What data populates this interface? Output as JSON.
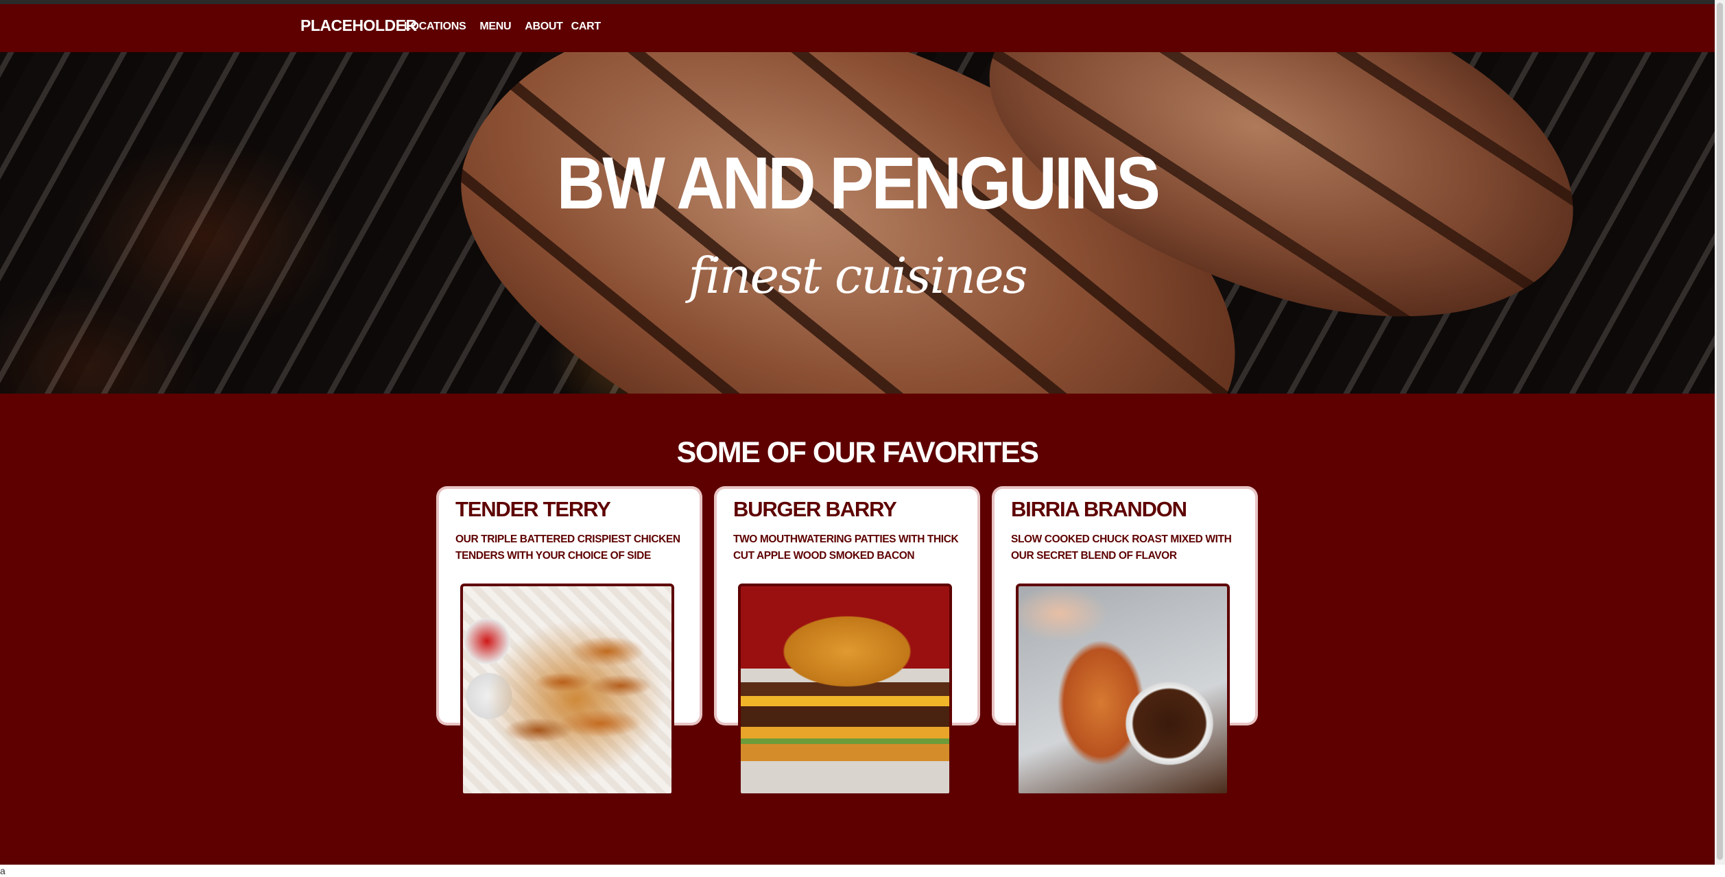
{
  "navbar": {
    "brand": "PLACEHOLDER",
    "links": [
      "LOCATIONS",
      "MENU",
      "ABOUT",
      "CART"
    ]
  },
  "hero": {
    "title": "BW AND PENGUINS",
    "subtitle": "finest cuisines"
  },
  "favorites": {
    "heading": "SOME OF OUR FAVORITES",
    "cards": [
      {
        "title": "TENDER TERRY",
        "description": "OUR TRIPLE BATTERED CRISPIEST CHICKEN TENDERS WITH YOUR CHOICE OF SIDE"
      },
      {
        "title": "BURGER BARRY",
        "description": "TWO MOUTHWATERING PATTIES WITH THICK CUT APPLE WOOD SMOKED BACON"
      },
      {
        "title": "BIRRIA BRANDON",
        "description": "SLOW COOKED CHUCK ROAST MIXED WITH OUR SECRET BLEND OF FLAVOR"
      }
    ]
  },
  "footer": {
    "text": "a"
  },
  "colors": {
    "brand": "#5e0000",
    "text_light": "#ffffff",
    "card_bg": "#ffffff"
  }
}
